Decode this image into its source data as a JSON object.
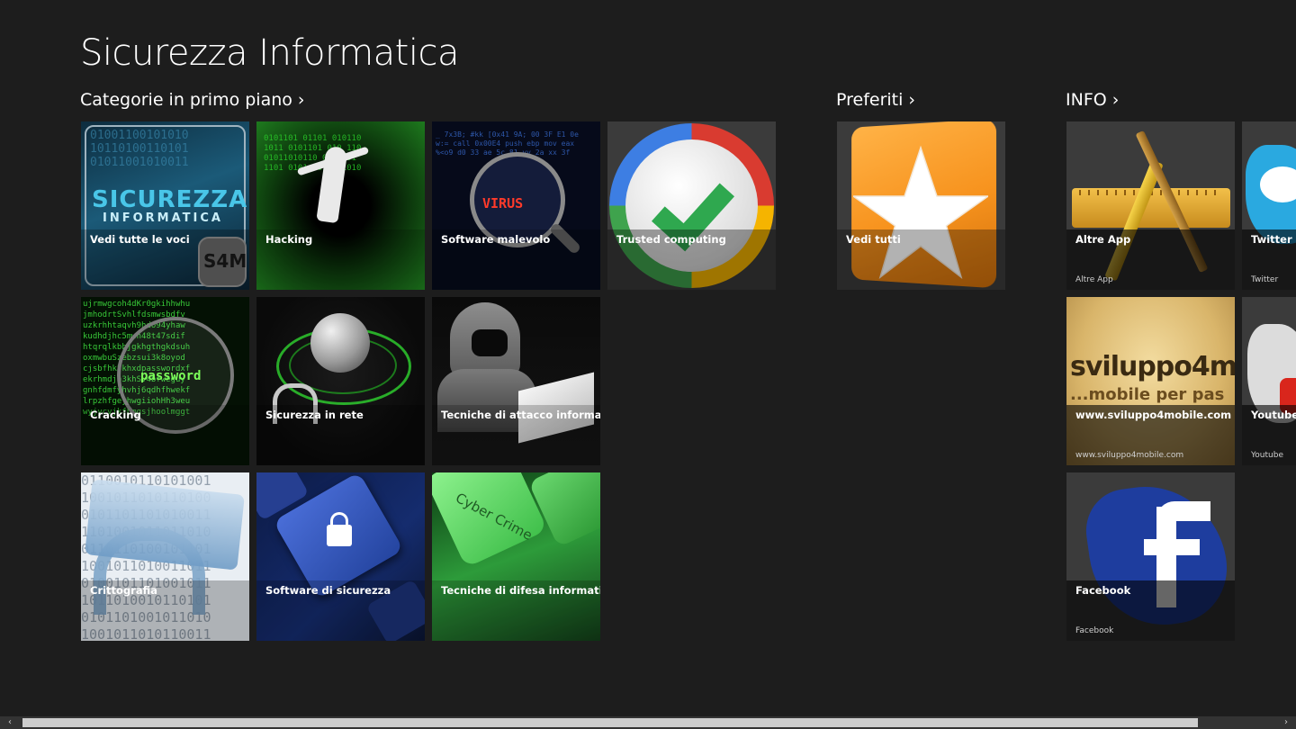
{
  "app": {
    "title": "Sicurezza Informatica"
  },
  "sections": {
    "categorie": {
      "label": "Categorie in primo piano",
      "chevron": "›"
    },
    "preferiti": {
      "label": "Preferiti",
      "chevron": "›"
    },
    "info": {
      "label": "INFO",
      "chevron": "›"
    }
  },
  "tiles": {
    "vedi_tutte": {
      "title": "Vedi tutte le voci",
      "art_line1": "SICUREZZA",
      "art_line2": "INFORMATICA",
      "art_badge": "S4M"
    },
    "hacking": {
      "title": "Hacking"
    },
    "malware": {
      "title": "Software malevolo",
      "art_text": "VIRUS"
    },
    "trusted": {
      "title": "Trusted computing"
    },
    "cracking": {
      "title": "Cracking",
      "art_text": "password"
    },
    "rete": {
      "title": "Sicurezza in rete"
    },
    "attacco": {
      "title": "Tecniche di attacco informatico"
    },
    "crittografia": {
      "title": "Crittografia"
    },
    "sw_sicurezza": {
      "title": "Software di sicurezza"
    },
    "difesa": {
      "title": "Tecniche di difesa informatica",
      "art_text": "Cyber Crime"
    },
    "vedi_tutti": {
      "title": "Vedi tutti"
    },
    "altre_app": {
      "title": "Altre App",
      "sub": "Altre App"
    },
    "twitter": {
      "title": "Twitter",
      "sub": "Twitter"
    },
    "sviluppo": {
      "title": "www.sviluppo4mobile.com",
      "sub": "www.sviluppo4mobile.com",
      "art_line1": "sviluppo4m",
      "art_line2": "...mobile per pas"
    },
    "youtube": {
      "title": "Youtube",
      "sub": "Youtube"
    },
    "facebook": {
      "title": "Facebook",
      "sub": "Facebook"
    }
  },
  "scrollbar": {
    "left_arrow": "‹",
    "right_arrow": "›"
  },
  "colors": {
    "background": "#1d1d1d",
    "label_overlay": "rgba(0,0,0,0.6)",
    "accent_orange": "#f7931e",
    "matrix_green": "#2bd42b"
  }
}
